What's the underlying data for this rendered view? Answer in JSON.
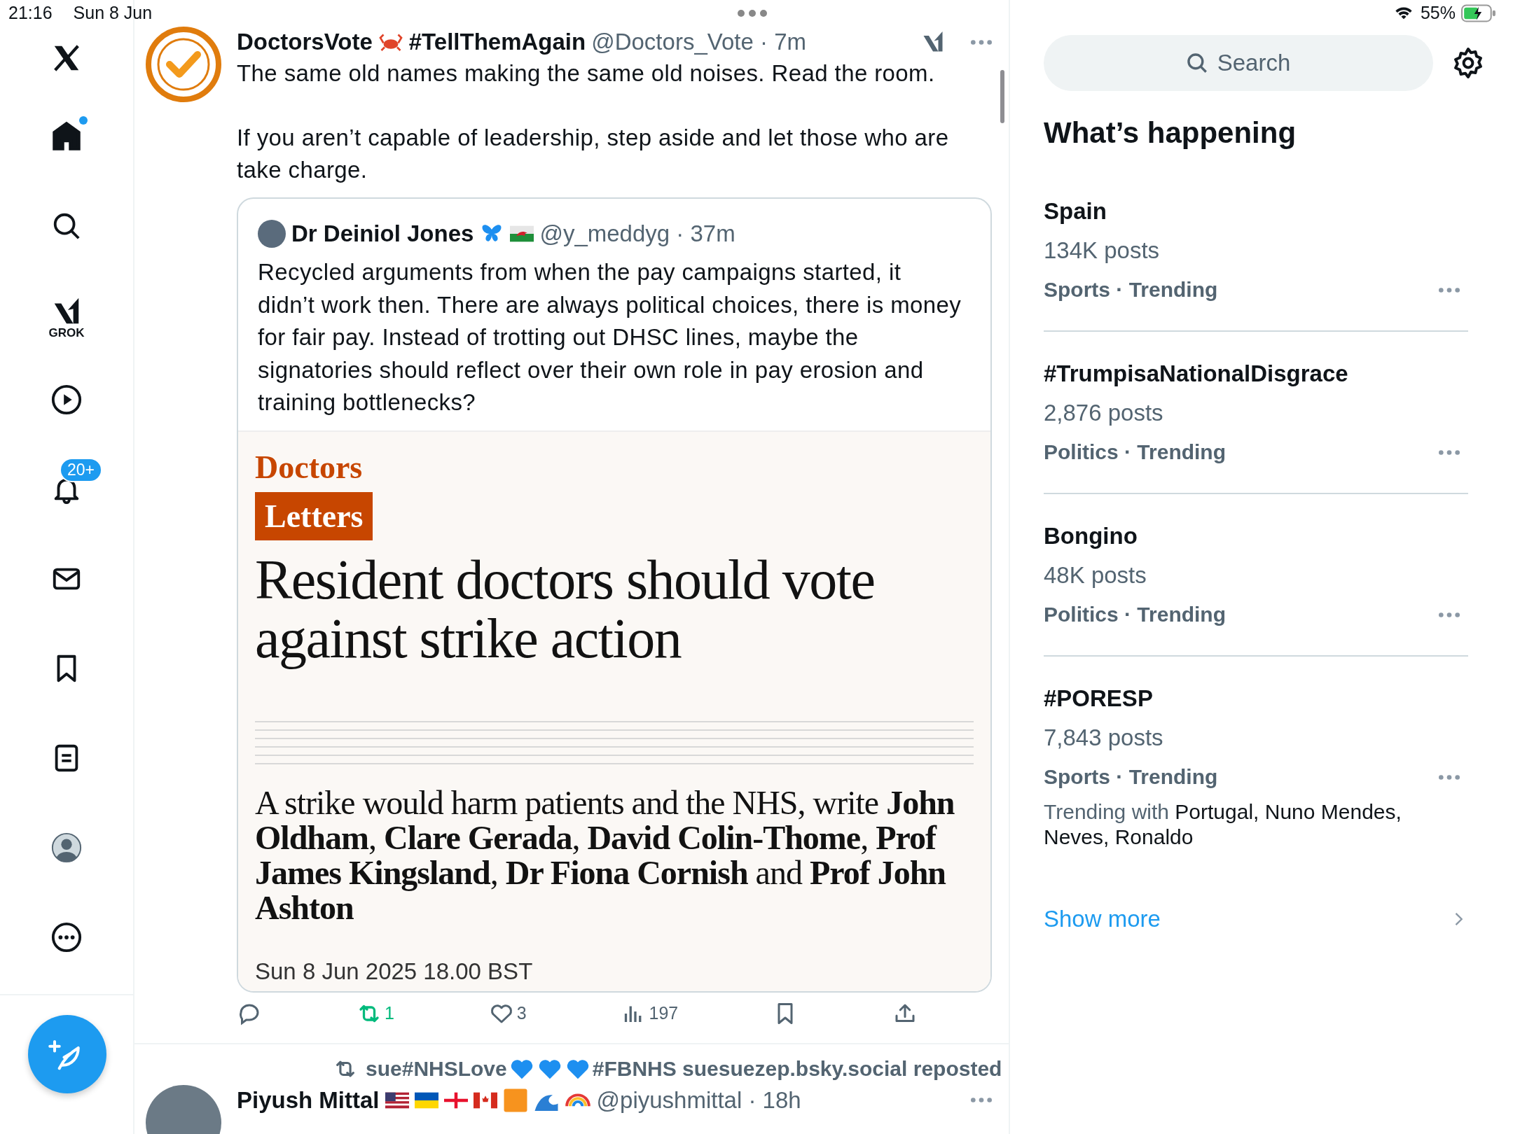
{
  "status_bar": {
    "time": "21:16",
    "date": "Sun 8 Jun",
    "battery": "55%"
  },
  "nav": {
    "items": [
      {
        "kind": "home",
        "selected": true,
        "unread": true
      },
      {
        "kind": "search",
        "selected": false
      },
      {
        "kind": "grok",
        "selected": false,
        "label": "GROK"
      },
      {
        "kind": "video",
        "selected": false
      },
      {
        "kind": "notifications",
        "selected": false,
        "badge": "20+"
      },
      {
        "kind": "messages",
        "selected": false
      },
      {
        "kind": "bookmarks",
        "selected": false
      },
      {
        "kind": "lists",
        "selected": false
      },
      {
        "kind": "profile",
        "selected": false
      },
      {
        "kind": "more",
        "selected": false
      }
    ]
  },
  "tweet": {
    "name": "DoctorsVote",
    "name_suffix": "#TellThemAgain",
    "handle_time": "@Doctors_Vote · 7m",
    "paragraphs": [
      "The same old names making the same old noises. Read the room.",
      "If you aren’t capable of leadership, step aside and let those who are take charge."
    ],
    "quote": {
      "name": "Dr Deiniol Jones",
      "handle_time": "@y_meddyg · 37m",
      "text": "Recycled arguments from when the pay campaigns started, it didn’t work then. There are always political choices, there is money for fair pay. Instead of trotting out DHSC lines, maybe the signatories should reflect over their own role in pay erosion and training bottlenecks?",
      "article": {
        "section": "Doctors",
        "label": "Letters",
        "headline": "Resident doctors should vote against strike action",
        "standfirst": "A strike would harm patients and the NHS, write **John Oldham**, **Clare Gerada**, **David Colin-Thome**, **Prof James Kingsland**, **Dr Fiona Cornish** and **Prof John Ashton**",
        "date": "Sun 8 Jun 2025 18.00 BST"
      }
    },
    "actions": [
      {
        "kind": "reply"
      },
      {
        "kind": "repost",
        "count": "1",
        "active": true
      },
      {
        "kind": "like",
        "count": "3",
        "active": false
      },
      {
        "kind": "views",
        "count": "197"
      },
      {
        "kind": "bookmark",
        "active": false
      },
      {
        "kind": "share"
      }
    ]
  },
  "next_tweet": {
    "reposted_by_start": "sue#NHSLove",
    "reposted_by_end": "#FBNHS suesuezep.bsky.social reposted",
    "name": "Piyush Mittal",
    "handle_time": "@piyushmittal · 18h"
  },
  "sidebar": {
    "search": {
      "placeholder": "Search"
    },
    "title": "What’s happening",
    "trends": [
      {
        "name": "Spain",
        "posts": "134K posts",
        "category": "Sports · Trending"
      },
      {
        "name": "#TrumpisaNationalDisgrace",
        "posts": "2,876 posts",
        "category": "Politics · Trending"
      },
      {
        "name": "Bongino",
        "posts": "48K posts",
        "category": "Politics · Trending"
      },
      {
        "name": "#PORESP",
        "posts": "7,843 posts",
        "category": "Sports · Trending",
        "trending_with_label": "Trending with",
        "trending_with": "Portugal, Nuno Mendes, Neves, Ronaldo"
      }
    ],
    "show_more": "Show more"
  }
}
